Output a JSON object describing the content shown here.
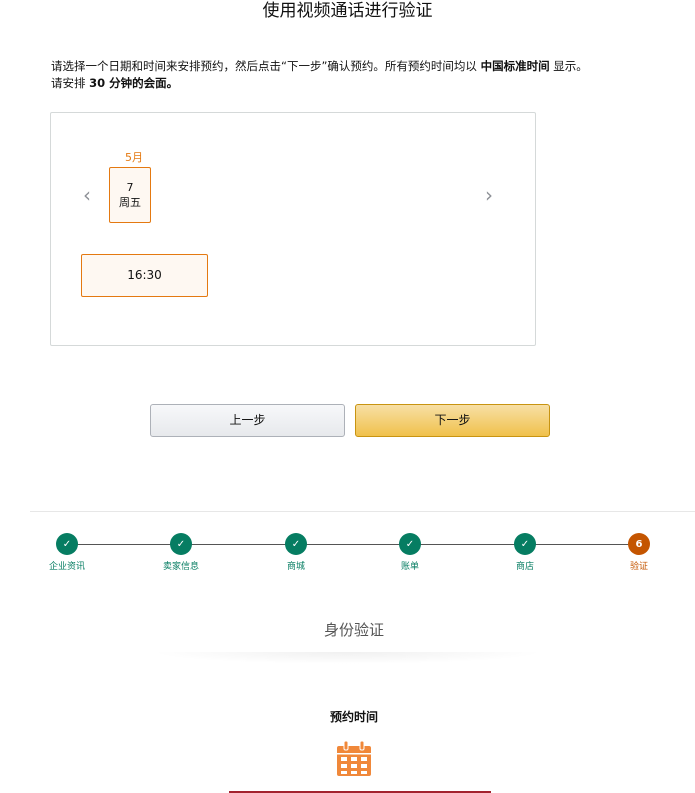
{
  "page": {
    "title": "使用视频通话进行验证",
    "instruction_line1_a": "请选择一个日期和时间来安排预约，然后点击“下一步”确认预约。所有预约时间均以 ",
    "instruction_line1_bold": "中国标准时间",
    "instruction_line1_b": " 显示。",
    "instruction_line2_a": "请安排 ",
    "instruction_line2_bold": "30 分钟的会面。"
  },
  "calendar": {
    "month": "5月",
    "prev_icon": "‹",
    "next_icon": "›",
    "selected_date": {
      "day": "7",
      "weekday": "周五"
    },
    "time_slot": "16:30"
  },
  "buttons": {
    "prev_label": "上一步",
    "next_label": "下一步"
  },
  "stepper": {
    "steps": [
      {
        "label": "企业资讯",
        "status": "done",
        "icon": "✓"
      },
      {
        "label": "卖家信息",
        "status": "done",
        "icon": "✓"
      },
      {
        "label": "商城",
        "status": "done",
        "icon": "✓"
      },
      {
        "label": "账单",
        "status": "done",
        "icon": "✓"
      },
      {
        "label": "商店",
        "status": "done",
        "icon": "✓"
      },
      {
        "label": "验证",
        "status": "current",
        "icon": "6"
      }
    ]
  },
  "section": {
    "title": "身份验证",
    "appointment_heading": "预约时间",
    "icon": "calendar-icon"
  },
  "colors": {
    "accent_orange": "#e47911",
    "done_green": "#067d62",
    "current_orange": "#c45500",
    "next_button": "#f0c14b",
    "calendar_icon": "#f0883a",
    "bottom_line": "#a3232f"
  }
}
